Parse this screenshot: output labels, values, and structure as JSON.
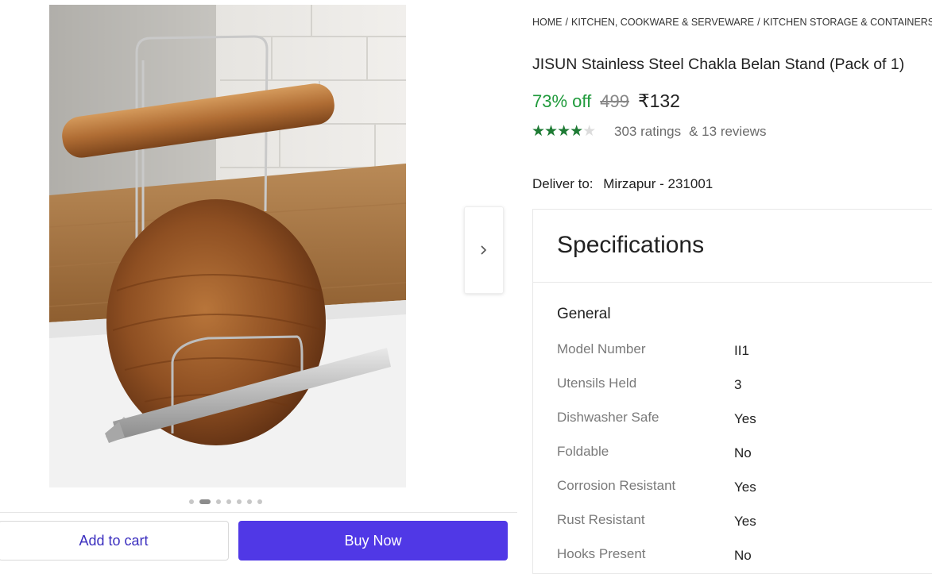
{
  "breadcrumb": [
    "Home",
    "Kitchen, Cookware & Serveware",
    "Kitchen Storage & Containers"
  ],
  "product": {
    "title": "JISUN Stainless Steel Chakla Belan Stand (Pack of 1)",
    "discount": "73% off",
    "mrp": "499",
    "price": "₹132",
    "rating_value": 3.5,
    "rating_max": 5,
    "ratings": "303 ratings",
    "reviews": "& 13 reviews"
  },
  "delivery": {
    "label": "Deliver to:",
    "location": "Mirzapur - 231001"
  },
  "gallery": {
    "image_count": 7,
    "active_index": 1,
    "next_icon": "chevron-right-icon"
  },
  "actions": {
    "add_to_cart": "Add to cart",
    "buy_now": "Buy Now"
  },
  "specifications": {
    "title": "Specifications",
    "group": "General",
    "rows": [
      {
        "label": "Model Number",
        "value": "II1"
      },
      {
        "label": "Utensils Held",
        "value": "3"
      },
      {
        "label": "Dishwasher Safe",
        "value": "Yes"
      },
      {
        "label": "Foldable",
        "value": "No"
      },
      {
        "label": "Corrosion Resistant",
        "value": "Yes"
      },
      {
        "label": "Rust Resistant",
        "value": "Yes"
      },
      {
        "label": "Hooks Present",
        "value": "No"
      }
    ]
  },
  "colors": {
    "discount": "#1f9a3b",
    "buy_button": "#5038e6",
    "cart_text": "#3b2fbf",
    "stars": "#1e7b34"
  }
}
